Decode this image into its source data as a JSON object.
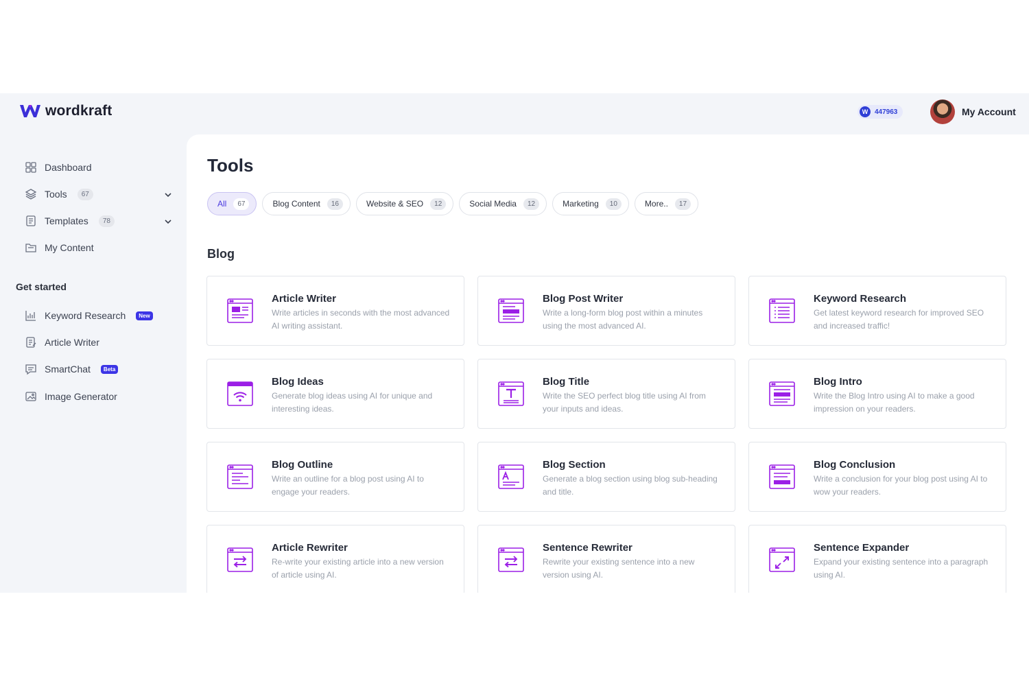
{
  "app": {
    "name": "wordkraft"
  },
  "header": {
    "credits": "447963",
    "credits_icon": "W",
    "account_label": "My Account"
  },
  "sidebar": {
    "items": [
      {
        "label": "Dashboard"
      },
      {
        "label": "Tools",
        "count": "67"
      },
      {
        "label": "Templates",
        "count": "78"
      },
      {
        "label": "My Content"
      }
    ],
    "section_title": "Get started",
    "get_started": [
      {
        "label": "Keyword Research",
        "badge": "New"
      },
      {
        "label": "Article Writer"
      },
      {
        "label": "SmartChat",
        "badge": "Beta"
      },
      {
        "label": "Image Generator"
      }
    ]
  },
  "main": {
    "title": "Tools",
    "tabs": [
      {
        "label": "All",
        "count": "67"
      },
      {
        "label": "Blog Content",
        "count": "16"
      },
      {
        "label": "Website & SEO",
        "count": "12"
      },
      {
        "label": "Social Media",
        "count": "12"
      },
      {
        "label": "Marketing",
        "count": "10"
      },
      {
        "label": "More..",
        "count": "17"
      }
    ],
    "section_heading": "Blog",
    "cards": [
      {
        "title": "Article Writer",
        "desc": "Write articles in seconds with the most advanced AI writing assistant.",
        "icon": "article-icon"
      },
      {
        "title": "Blog Post Writer",
        "desc": "Write a long-form blog post within a minutes using the most advanced AI.",
        "icon": "blog-post-icon"
      },
      {
        "title": "Keyword Research",
        "desc": "Get latest keyword research for improved SEO and increased traffic!",
        "icon": "list-icon"
      },
      {
        "title": "Blog Ideas",
        "desc": "Generate blog ideas using AI for unique and interesting ideas.",
        "icon": "wifi-icon"
      },
      {
        "title": "Blog Title",
        "desc": "Write the SEO perfect blog title using AI from your inputs and ideas.",
        "icon": "title-icon"
      },
      {
        "title": "Blog Intro",
        "desc": "Write the Blog Intro using AI to make a good impression on your readers.",
        "icon": "intro-icon"
      },
      {
        "title": "Blog Outline",
        "desc": "Write an outline for a blog post using AI to engage your readers.",
        "icon": "outline-icon"
      },
      {
        "title": "Blog Section",
        "desc": "Generate a blog section using blog sub-heading and title.",
        "icon": "section-icon"
      },
      {
        "title": "Blog Conclusion",
        "desc": "Write a conclusion for your blog post using AI to wow your readers.",
        "icon": "conclusion-icon"
      },
      {
        "title": "Article Rewriter",
        "desc": "Re-write your existing article into a new version of article using AI.",
        "icon": "swap-icon"
      },
      {
        "title": "Sentence Rewriter",
        "desc": "Rewrite your existing sentence into a new version using AI.",
        "icon": "swap-icon"
      },
      {
        "title": "Sentence Expander",
        "desc": "Expand your existing sentence into a paragraph using AI.",
        "icon": "expand-icon"
      }
    ]
  },
  "colors": {
    "accent": "#4b3ae0",
    "icon": "#9b1fe6",
    "badge": "#3c35e6"
  }
}
